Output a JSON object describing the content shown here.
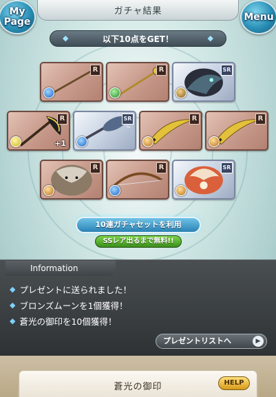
{
  "header": {
    "title": "ガチャ結果",
    "left_button": "My\nPage",
    "right_button": "Menu"
  },
  "banner": {
    "text": "以下10点をGET！"
  },
  "items": [
    {
      "rarity": "R",
      "element": "water",
      "icon": "spear-weapon-icon"
    },
    {
      "rarity": "R",
      "element": "wind",
      "icon": "staff-weapon-icon"
    },
    {
      "rarity": "SR",
      "element": "dark",
      "icon": "dark-summon-icon"
    },
    {
      "rarity": "R",
      "element": "light",
      "icon": "axe-weapon-icon",
      "plus": "+1"
    },
    {
      "rarity": "SR",
      "element": "water",
      "icon": "spiked-club-weapon-icon"
    },
    {
      "rarity": "R",
      "element": "fire",
      "icon": "scimitar-weapon-icon"
    },
    {
      "rarity": "R",
      "element": "fire",
      "icon": "scimitar-weapon-icon"
    },
    {
      "rarity": "R",
      "element": "fire",
      "icon": "beast-summon-icon"
    },
    {
      "rarity": "R",
      "element": "water",
      "icon": "bow-weapon-icon"
    },
    {
      "rarity": "SR",
      "element": "fire",
      "icon": "fire-summon-icon"
    }
  ],
  "gacha_set": {
    "button": "10連ガチャセットを利用",
    "badge": "SSレア出るまで無料!!"
  },
  "information": {
    "title": "Information",
    "lines": [
      "プレゼントに送られました！",
      "ブロンズムーンを1個獲得！",
      "蒼光の御印を10個獲得！"
    ],
    "present_button": "プレゼントリストへ"
  },
  "bottom": {
    "title": "蒼光の御印",
    "help": "HELP"
  },
  "colors": {
    "accent": "#2b83b5",
    "panel": "#3a3f42",
    "r_frame": "#c99c8d",
    "sr_frame": "#c9d4e4"
  }
}
